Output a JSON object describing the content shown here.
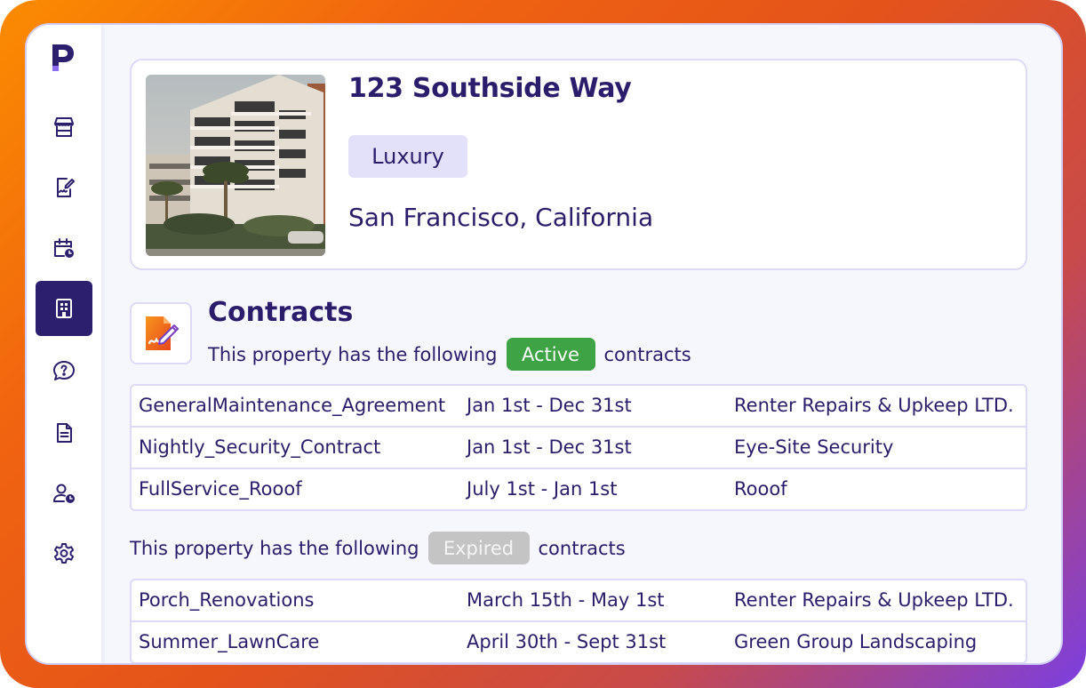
{
  "property": {
    "title": "123 Southside Way",
    "tag": "Luxury",
    "location": "San Francisco, California"
  },
  "contracts": {
    "title": "Contracts",
    "active_prefix": "This property has the following",
    "active_badge": "Active",
    "active_suffix": "contracts",
    "active_rows": [
      {
        "name": "GeneralMaintenance_Agreement",
        "dates": "Jan 1st - Dec 31st",
        "vendor": "Renter Repairs & Upkeep LTD."
      },
      {
        "name": "Nightly_Security_Contract",
        "dates": "Jan 1st - Dec 31st",
        "vendor": "Eye-Site Security"
      },
      {
        "name": "FullService_Rooof",
        "dates": "July 1st - Jan 1st",
        "vendor": "Rooof"
      }
    ],
    "expired_prefix": "This property has the following",
    "expired_badge": "Expired",
    "expired_suffix": "contracts",
    "expired_rows": [
      {
        "name": "Porch_Renovations",
        "dates": "March 15th - May 1st",
        "vendor": "Renter Repairs & Upkeep LTD."
      },
      {
        "name": "Summer_LawnCare",
        "dates": "April 30th - Sept 31st",
        "vendor": "Green Group Landscaping"
      }
    ]
  },
  "sidebar": {
    "items": [
      {
        "icon": "storefront-icon"
      },
      {
        "icon": "signed-document-icon"
      },
      {
        "icon": "calendar-clock-icon"
      },
      {
        "icon": "building-icon",
        "active": true
      },
      {
        "icon": "help-chat-icon"
      },
      {
        "icon": "document-icon"
      },
      {
        "icon": "user-clock-icon"
      },
      {
        "icon": "gear-icon"
      }
    ]
  },
  "colors": {
    "accent": "#2c1f6e",
    "active_badge": "#3ea344",
    "expired_badge": "#c4c4c4",
    "tag_bg": "#e3e0fa"
  }
}
